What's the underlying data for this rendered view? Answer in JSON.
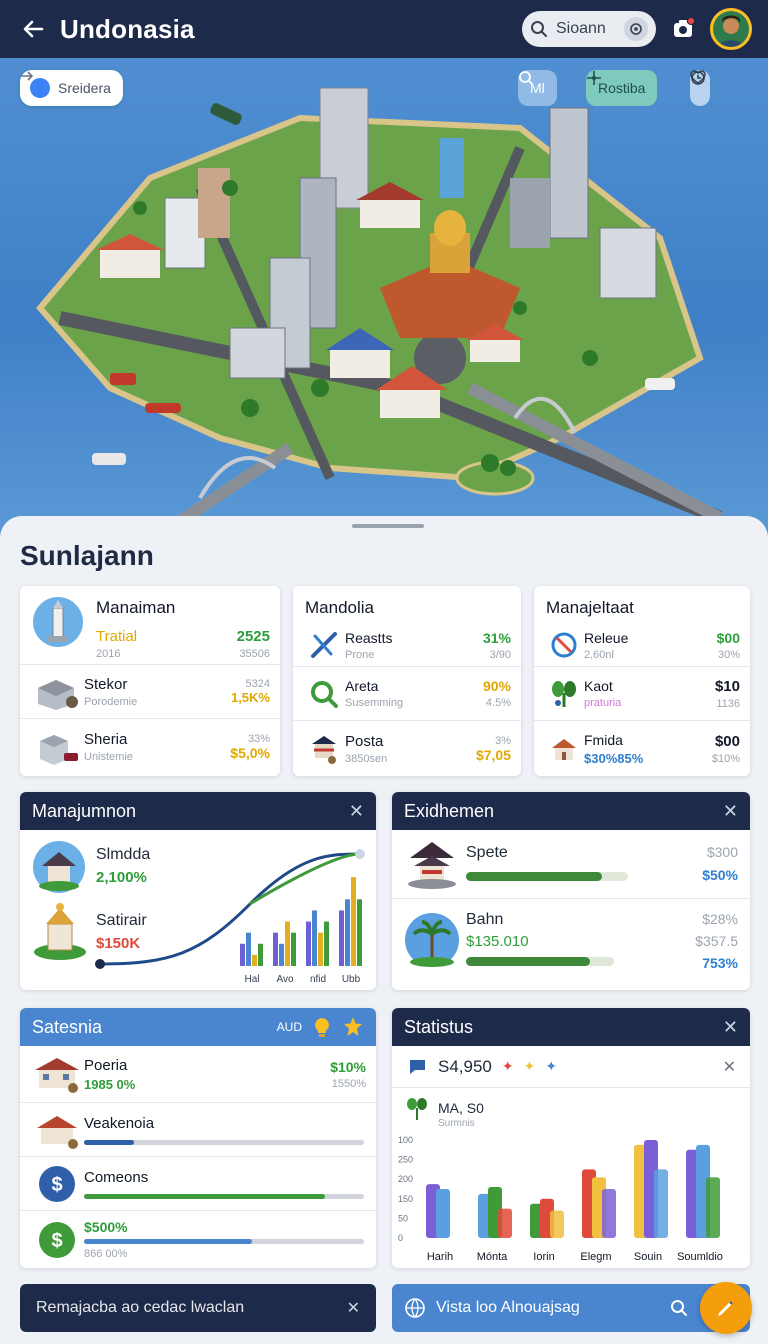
{
  "header": {
    "title": "Undonasia",
    "search_label": "Sioann",
    "back_icon": "arrow-left-icon",
    "camera_icon": "camera-icon"
  },
  "hero": {
    "chip_left": "Sreidera",
    "chip_mid": "Ml",
    "chip_right": "Rostiba"
  },
  "section_title": "Sunlajann",
  "cards_top": [
    {
      "title": "Manaiman",
      "rows": [
        {
          "name": "Tratial",
          "sub": "2016",
          "v1": "2525",
          "v2": "35506",
          "name_color": "#e0a800",
          "v1_color": "#2e9d3a"
        },
        {
          "name": "Stekor",
          "sub": "Porodemie",
          "v1": "5324",
          "v2": "1,5K%",
          "v1_color": "#9ca3af",
          "v2_color": "#e0a800"
        },
        {
          "name": "Sheria",
          "sub": "Unistemie",
          "v1": "33%",
          "v2": "$5,0%",
          "v1_color": "#9ca3af",
          "v2_color": "#e0a800"
        }
      ]
    },
    {
      "title": "Mandolia",
      "rows": [
        {
          "name": "Reastts",
          "sub": "Prone",
          "v1": "31%",
          "v2": "3/90",
          "name_color": "#2f7fd0",
          "v1_color": "#2e9d3a"
        },
        {
          "name": "Areta",
          "sub": "Susemming",
          "v1": "90%",
          "v2": "4.5%",
          "name_color": "#2f7fd0",
          "v1_color": "#e0a800"
        },
        {
          "name": "Posta",
          "sub": "3850sen",
          "v1": "3%",
          "v2": "$7,05",
          "v1_color": "#9ca3af",
          "v2_color": "#e0a800"
        }
      ]
    },
    {
      "title": "Manajeltaat",
      "rows": [
        {
          "name": "Releue",
          "sub": "2,60nl",
          "v1": "$00",
          "v2": "30%",
          "v1_color": "#2e9d3a"
        },
        {
          "name": "Kaot",
          "sub": "praturia",
          "v1": "$10",
          "v2": "1136",
          "v1_color": "#111827",
          "sub_color": "#d07ad0"
        },
        {
          "name": "Fmida",
          "sub": "$30%85%",
          "v1": "$00",
          "v2": "$10%",
          "v1_color": "#111827",
          "sub_color": "#2f7fd0"
        }
      ]
    }
  ],
  "card_manajumnon": {
    "title": "Manajumnon",
    "items": [
      {
        "name": "Slmdda",
        "value": "2,100%",
        "value_color": "#2e9d3a"
      },
      {
        "name": "Satirair",
        "value": "$150K",
        "value_color": "#e04a3a"
      }
    ],
    "chart_data": {
      "type": "bar",
      "categories": [
        "Hal",
        "Avo",
        "nfid",
        "Ubb"
      ],
      "series": [
        {
          "values": [
            2,
            3,
            4,
            5
          ]
        },
        {
          "values": [
            3,
            2,
            5,
            6
          ]
        },
        {
          "values": [
            1,
            4,
            3,
            8
          ]
        },
        {
          "values": [
            2,
            3,
            4,
            6
          ]
        }
      ],
      "colors": [
        "#6d5fd6",
        "#4a86d0",
        "#e0b020",
        "#3f9a3a"
      ],
      "trend_color": "#3f8a3a"
    }
  },
  "card_exidhemen": {
    "title": "Exidhemen",
    "items": [
      {
        "name": "Spete",
        "v1": "$300",
        "v2": "$50%",
        "bar": 0.84
      },
      {
        "name": "Bahn",
        "value": "$135.010",
        "v1": "$28%",
        "v1b": "$357.5",
        "v2": "753%",
        "bar": 0.84
      }
    ]
  },
  "card_satesnia": {
    "title": "Satesnia",
    "aud": "AUD",
    "items": [
      {
        "name": "Poeria",
        "sub": "1985 0%",
        "v1": "$10%",
        "v2": "1550%",
        "name_color": "#e04a3a"
      },
      {
        "name": "Veakenoia",
        "progress": 0.18,
        "color": "#2f5fa8"
      },
      {
        "name": "Comeons",
        "progress": 0.86,
        "color": "#3f9a3a"
      },
      {
        "name": "$500%",
        "sub": "866 00%",
        "progress": 0.6,
        "color": "#4a86d0"
      }
    ]
  },
  "card_statistus": {
    "title": "Statistus",
    "amount": "S4,950",
    "sub_title": "MA, S0",
    "sub_caption": "Surmnis",
    "chart_data": {
      "type": "bar",
      "categories": [
        "Harih",
        "Mónta",
        "Iorin",
        "Elegm",
        "Souin",
        "Soumldio"
      ],
      "y_ticks": [
        "100",
        "250",
        "200",
        "150",
        "50",
        "0"
      ],
      "series": [
        {
          "values": [
            55,
            45,
            35,
            70,
            95,
            90
          ]
        },
        {
          "values": [
            50,
            52,
            40,
            62,
            100,
            95
          ]
        },
        {
          "values": [
            0,
            30,
            28,
            50,
            70,
            62
          ]
        }
      ],
      "colors": [
        "#7b5fd6",
        "#5aa0e0",
        "#3f9a3a",
        "#e04a3a",
        "#f0c040"
      ]
    }
  },
  "footer": {
    "left_text": "Remajacba ao cedac lwaclan",
    "right_text": "Vista loo Alnouajsag"
  }
}
